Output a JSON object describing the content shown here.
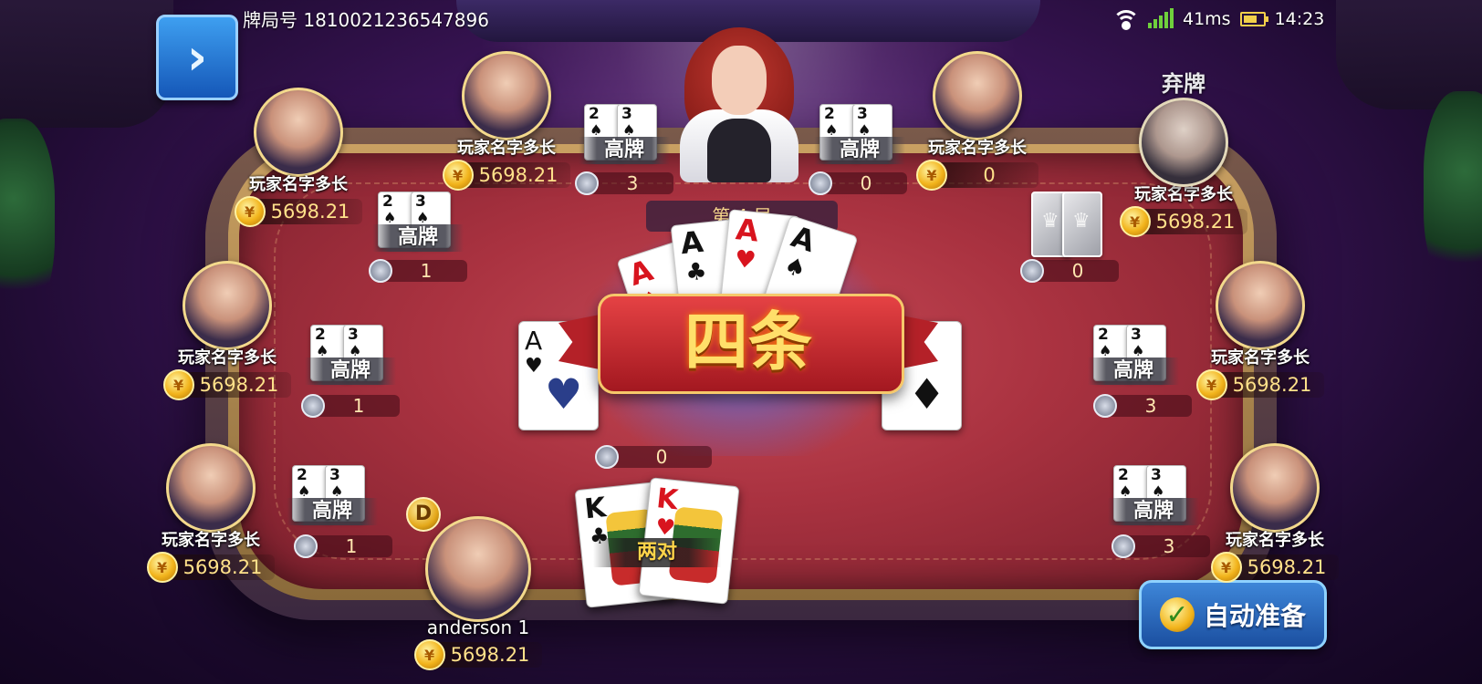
{
  "header": {
    "room_id_label": "牌局号 1810021236547896",
    "latency": "41ms",
    "time": "14:23"
  },
  "round_info": "第 4 局",
  "hand_result": "四条",
  "center_bet": "0",
  "self": {
    "name": "anderson 1",
    "balance": "5698.21",
    "hand_label": "两对",
    "cards": [
      {
        "rank": "K",
        "suit": "♣",
        "color": "black"
      },
      {
        "rank": "K",
        "suit": "♥",
        "color": "red"
      }
    ],
    "dealer_marker": "D"
  },
  "players": [
    {
      "id": "p1",
      "name": "玩家名字多长",
      "balance": "5698.21",
      "hand": "高牌",
      "bet": "3"
    },
    {
      "id": "p2",
      "name": "玩家名字多长",
      "balance": "0",
      "hand": "高牌",
      "bet": "0"
    },
    {
      "id": "p3",
      "name": "玩家名字多长",
      "balance": "5698.21",
      "hand": "高牌",
      "bet": "1"
    },
    {
      "id": "p4",
      "name": "玩家名字多长",
      "balance": "5698.21",
      "status": "弃牌",
      "bet": "0"
    },
    {
      "id": "p5",
      "name": "玩家名字多长",
      "balance": "5698.21",
      "hand": "高牌",
      "bet": "1"
    },
    {
      "id": "p6",
      "name": "玩家名字多长",
      "balance": "5698.21",
      "hand": "高牌",
      "bet": "3"
    },
    {
      "id": "p7",
      "name": "玩家名字多长",
      "balance": "5698.21",
      "hand": "高牌",
      "bet": "1"
    },
    {
      "id": "p8",
      "name": "玩家名字多长",
      "balance": "5698.21",
      "hand": "高牌",
      "bet": "3"
    }
  ],
  "small_cards": [
    {
      "rank": "2",
      "suit": "♠"
    },
    {
      "rank": "3",
      "suit": "♠"
    }
  ],
  "community_aces": [
    {
      "rank": "A",
      "suit": "♦",
      "color": "red"
    },
    {
      "rank": "A",
      "suit": "♣",
      "color": "black"
    },
    {
      "rank": "A",
      "suit": "♥",
      "color": "red"
    },
    {
      "rank": "A",
      "suit": "♠",
      "color": "black"
    }
  ],
  "board_cards": [
    {
      "rank": "A",
      "suit": "♥",
      "color": "red"
    },
    {
      "suit": "♦",
      "color": "black"
    }
  ],
  "auto_ready_label": "自动准备",
  "icons": {
    "back": "chevron-right-icon",
    "coin": "coin-icon",
    "chip": "chip-icon",
    "check": "check-icon",
    "wifi": "wifi-icon",
    "signal": "signal-icon",
    "battery": "battery-icon"
  }
}
